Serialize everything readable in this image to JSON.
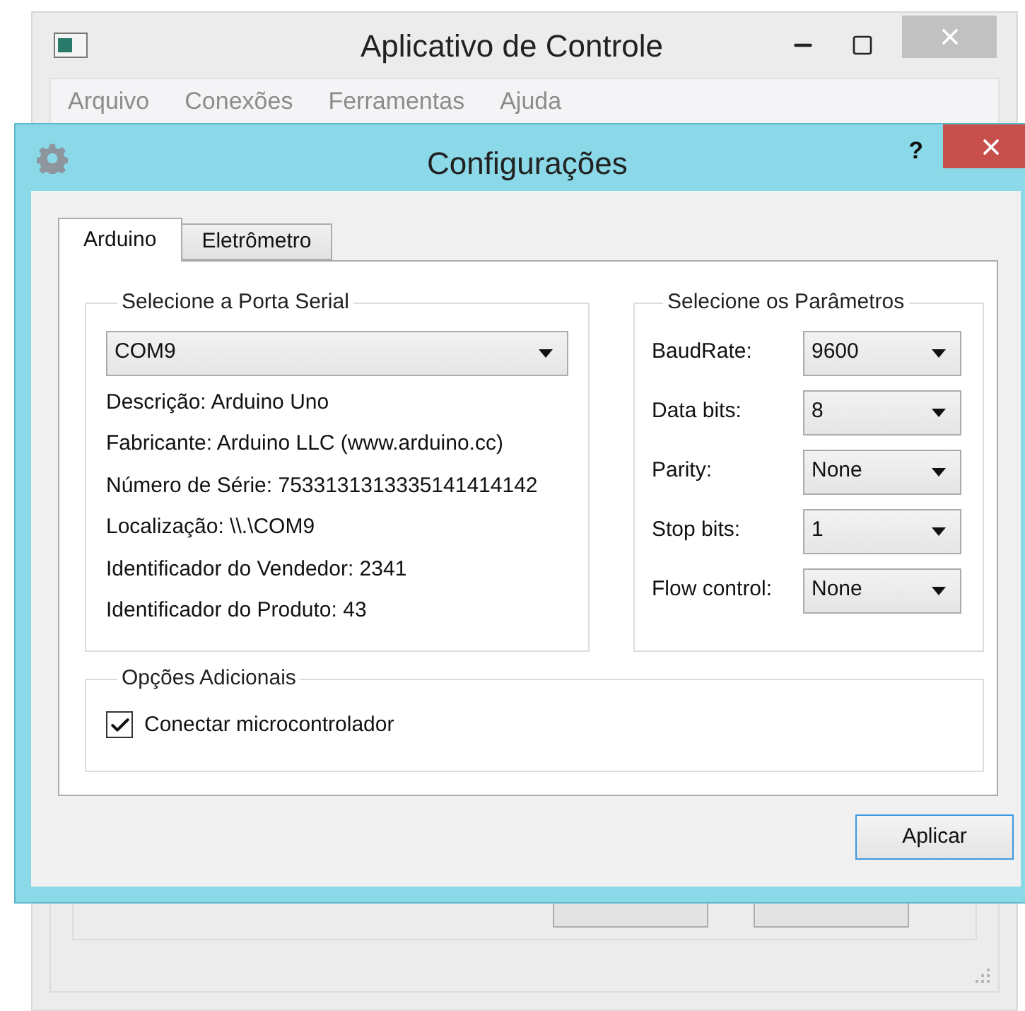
{
  "main_window": {
    "title": "Aplicativo de Controle",
    "menu": [
      "Arquivo",
      "Conexões",
      "Ferramentas",
      "Ajuda"
    ]
  },
  "dialog": {
    "title": "Configurações",
    "help": "?",
    "tabs": [
      {
        "label": "Arduino",
        "selected": true
      },
      {
        "label": "Eletrômetro",
        "selected": false
      }
    ],
    "serial_group": {
      "title": "Selecione a Porta Serial",
      "port": "COM9",
      "info": [
        "Descrição: Arduino Uno",
        "Fabricante: Arduino LLC (www.arduino.cc)",
        "Número de Série: 7533131313335141414142",
        "Localização: \\\\.\\COM9",
        "Identificador do Vendedor: 2341",
        "Identificador do Produto: 43"
      ]
    },
    "params_group": {
      "title": "Selecione os Parâmetros",
      "params": [
        {
          "label": "BaudRate:",
          "value": "9600"
        },
        {
          "label": "Data bits:",
          "value": "8"
        },
        {
          "label": "Parity:",
          "value": "None"
        },
        {
          "label": "Stop bits:",
          "value": "1"
        },
        {
          "label": "Flow control:",
          "value": "None"
        }
      ]
    },
    "options_group": {
      "title": "Opções Adicionais",
      "checkbox": {
        "label": "Conectar microcontrolador",
        "checked": true
      }
    },
    "apply_button": "Aplicar"
  }
}
